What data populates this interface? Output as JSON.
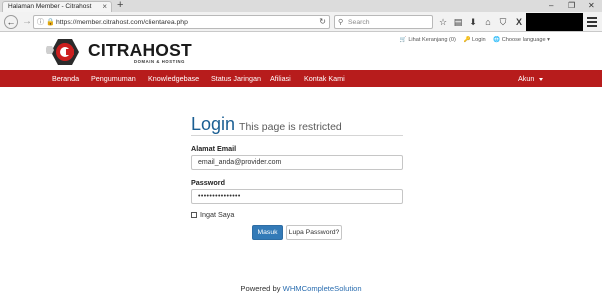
{
  "browser": {
    "tab_title": "Halaman Member - Citrahost",
    "tab_close": "×",
    "new_tab": "+",
    "window_controls": [
      "–",
      "❐",
      "✕"
    ],
    "url": "https://member.citrahost.com/clientarea.php",
    "search_placeholder": "Search",
    "icons": [
      "back-icon",
      "reload-icon",
      "star-icon",
      "reading-list-icon",
      "download-icon",
      "home-icon",
      "pocket-icon",
      "x-extension-icon",
      "menu-icon"
    ]
  },
  "header": {
    "logo_text": "CITRAHOST",
    "logo_subtext": "DOMAIN & HOSTING",
    "top_links": {
      "cart": "Lihat Keranjang (0)",
      "login": "Login",
      "language": "Choose language"
    }
  },
  "nav": {
    "items": [
      "Beranda",
      "Pengumuman",
      "Knowledgebase",
      "Status Jaringan",
      "Afiliasi",
      "Kontak Kami"
    ],
    "account": "Akun"
  },
  "login": {
    "title": "Login",
    "subtitle": "This page is restricted",
    "email_label": "Alamat Email",
    "email_value": "email_anda@provider.com",
    "password_label": "Password",
    "password_value": "•••••••••••••••",
    "remember_label": "Ingat Saya",
    "submit_label": "Masuk",
    "forgot_label": "Lupa Password?"
  },
  "footer": {
    "powered_by": "Powered by",
    "link_text": "WHMCompleteSolution"
  },
  "colors": {
    "nav_red": "#b71c1c",
    "title_blue": "#1b5f93",
    "button_blue": "#337ab7",
    "link_blue": "#2a6db0"
  }
}
